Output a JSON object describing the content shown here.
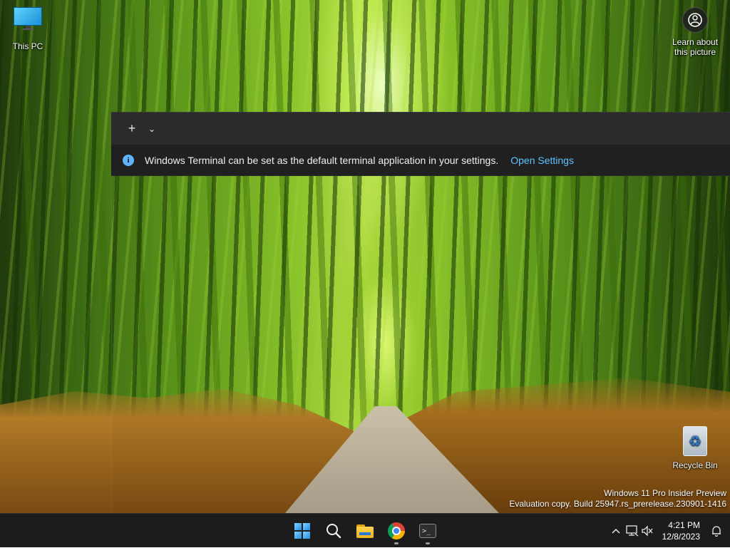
{
  "desktop": {
    "icons": [
      {
        "label": "This PC",
        "icon": "monitor-icon"
      },
      {
        "label": "Recycle Bin",
        "icon": "recycle-bin-icon"
      }
    ],
    "spotlight": {
      "label_line1": "Learn about",
      "label_line2": "this picture",
      "icon": "camera-circle-icon"
    }
  },
  "terminal": {
    "new_tab_glyph": "+",
    "dropdown_glyph": "⌄",
    "info_icon_glyph": "i",
    "info_message": "Windows Terminal can be set as the default terminal application in your settings.",
    "info_link": "Open Settings"
  },
  "watermark": {
    "line1": "Windows 11 Pro Insider Preview",
    "line2": "Evaluation copy. Build 25947.rs_prerelease.230901-1416"
  },
  "taskbar": {
    "apps": [
      {
        "name": "Start",
        "icon": "windows-logo-icon",
        "running": false
      },
      {
        "name": "Search",
        "icon": "search-icon",
        "running": false
      },
      {
        "name": "File Explorer",
        "icon": "folder-icon",
        "running": false
      },
      {
        "name": "Google Chrome",
        "icon": "chrome-icon",
        "running": true
      },
      {
        "name": "Terminal",
        "icon": "terminal-icon",
        "running": true
      }
    ],
    "terminal_prompt_glyph": ">_",
    "tray": {
      "chevron_glyph": "^",
      "time": "4:21 PM",
      "date": "12/8/2023"
    }
  },
  "colors": {
    "taskbar_bg": "#1c1c1c",
    "terminal_titlebar": "#2b2b2b",
    "info_link": "#60c3ff",
    "accent": "#1f8fe6"
  }
}
